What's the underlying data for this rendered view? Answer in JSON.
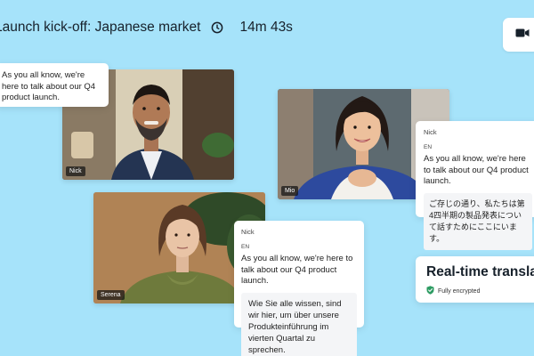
{
  "header": {
    "title": "Launch kick-off: Japanese market",
    "timer": "14m 43s"
  },
  "participants": {
    "nick": "Nick",
    "mio": "Mio",
    "serena": "Serena"
  },
  "captions": {
    "left_card": {
      "text": "As you all know, we're here to talk about our Q4 product launch."
    },
    "mio_card": {
      "speaker": "Nick",
      "lang": "EN",
      "original": "As you all know, we're here to talk about our Q4 product launch.",
      "translation": "ご存じの通り、私たちは第4四半期の製品発表について話すためにここにいます。"
    },
    "serena_card": {
      "speaker": "Nick",
      "lang": "EN",
      "original": "As you all know, we're here to talk about our Q4 product launch.",
      "translation": "Wie Sie alle wissen, sind wir hier, um über unsere Produkteinführung im vierten Quartal zu sprechen."
    }
  },
  "realtime": {
    "title": "Real-time translation",
    "status": "Fully encrypted"
  },
  "icons": {
    "clock": "clock-icon",
    "camera": "video-camera-icon",
    "shield": "shield-check-icon"
  },
  "colors": {
    "background": "#a6e3fa",
    "shield": "#2e9c63"
  }
}
